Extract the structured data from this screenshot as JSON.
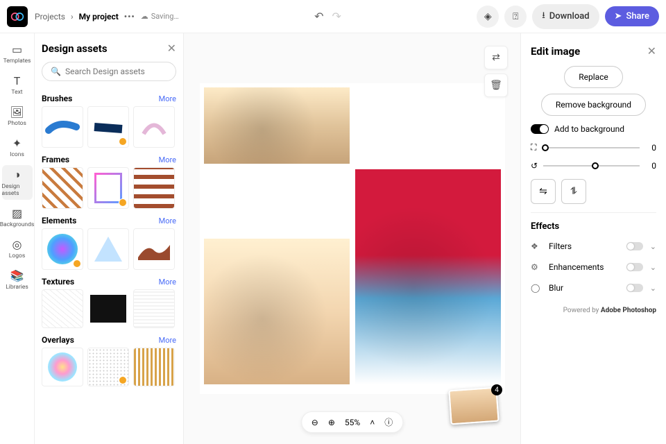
{
  "topbar": {
    "breadcrumb_root": "Projects",
    "breadcrumb_project": "My project",
    "status": "Saving…",
    "download": "Download",
    "share": "Share"
  },
  "nav": {
    "templates": "Templates",
    "text": "Text",
    "photos": "Photos",
    "icons": "Icons",
    "design_assets": "Design assets",
    "backgrounds": "Backgrounds",
    "logos": "Logos",
    "libraries": "Libraries"
  },
  "assets": {
    "title": "Design assets",
    "search_placeholder": "Search Design assets",
    "more": "More",
    "sections": {
      "brushes": "Brushes",
      "frames": "Frames",
      "elements": "Elements",
      "textures": "Textures",
      "overlays": "Overlays"
    }
  },
  "canvas": {
    "zoom_pct": "55%",
    "stack_count": "4"
  },
  "edit": {
    "title": "Edit image",
    "replace": "Replace",
    "remove_bg": "Remove background",
    "add_to_bg": "Add to background",
    "slider_crop_val": "0",
    "slider_rotate_val": "0",
    "effects_title": "Effects",
    "filters": "Filters",
    "enhancements": "Enhancements",
    "blur": "Blur",
    "powered_prefix": "Powered by ",
    "powered_brand": "Adobe Photoshop"
  }
}
